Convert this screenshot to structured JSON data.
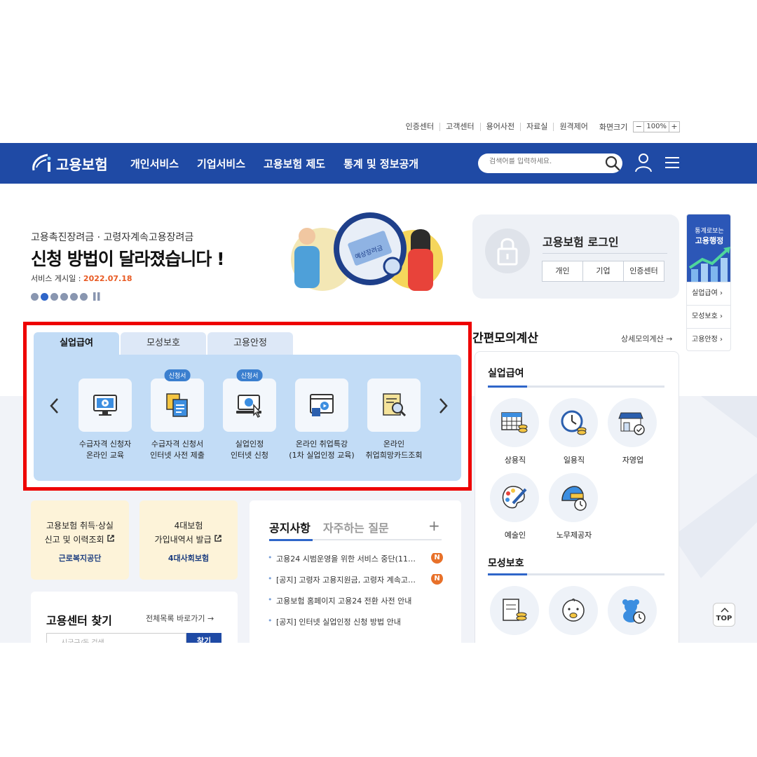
{
  "util": {
    "links": [
      "인증센터",
      "고객센터",
      "용어사전",
      "자료실",
      "원격제어"
    ],
    "zoom_label": "화면크기",
    "zoom_minus": "−",
    "zoom_value": "100%",
    "zoom_plus": "+"
  },
  "header": {
    "logo_text": "고용보험",
    "menu": [
      "개인서비스",
      "기업서비스",
      "고용보험 제도",
      "통계 및 정보공개"
    ],
    "search_placeholder": "검색어를 입력하세요."
  },
  "banner": {
    "subtitle": "고용촉진장려금 · 고령자계속고용장려금",
    "title": "신청 방법이 달라졌습니다 !",
    "date_label": "서비스 게시일 : ",
    "date_value": "2022.07.18",
    "illustration_tag": "예상장려금"
  },
  "login": {
    "title": "고용보험 로그인",
    "buttons": [
      "개인",
      "기업",
      "인증센터"
    ]
  },
  "quick_side": {
    "line1": "통계로보는",
    "line2": "고용행정",
    "items": [
      "실업급여 ›",
      "모성보호 ›",
      "고용안정 ›"
    ]
  },
  "service_tabs": {
    "tabs": [
      "실업급여",
      "모성보호",
      "고용안정"
    ],
    "active_tab": "실업급여",
    "items": [
      {
        "line1": "수급자격 신청자",
        "line2": "온라인 교육",
        "badge": ""
      },
      {
        "line1": "수급자격 신청서",
        "line2": "인터넷 사전 제출",
        "badge": "신청서"
      },
      {
        "line1": "실업인정",
        "line2": "인터넷 신청",
        "badge": "신청서"
      },
      {
        "line1": "온라인 취업특강",
        "line2": "(1차 실업인정 교육)",
        "badge": ""
      },
      {
        "line1": "온라인",
        "line2": "취업희망카드조회",
        "badge": ""
      }
    ]
  },
  "calc": {
    "title": "간편모의계산",
    "more": "상세모의계산 →",
    "section1": "실업급여",
    "section1_items": [
      "상용직",
      "일용직",
      "자영업",
      "예술인",
      "노무제공자"
    ],
    "section2": "모성보호"
  },
  "quick_links": [
    {
      "line1": "고용보험 취득·상실",
      "line2": "신고 및 이력조회",
      "org": "근로복지공단"
    },
    {
      "line1": "4대보험",
      "line2": "가입내역서 발급",
      "org": "4대사회보험"
    }
  ],
  "find_center": {
    "title": "고용센터 찾기",
    "more": "전체목록 바로가기 →",
    "placeholder": "시군구/동 검색",
    "button": "찾기"
  },
  "notice": {
    "tabs": [
      "공지사항",
      "자주하는 질문"
    ],
    "plus": "+",
    "items": [
      {
        "text": "고용24 시범운영을 위한 서비스 중단(11…",
        "new": "N"
      },
      {
        "text": "[공지] 고령자 고용지원금, 고령자 계속고…",
        "new": "N"
      },
      {
        "text": "고용보험 홈페이지 고용24 전환 사전 안내",
        "new": ""
      },
      {
        "text": "[공지] 인터넷 실업인정 신청 방법 안내",
        "new": ""
      }
    ]
  },
  "top_button": "TOP",
  "colors": {
    "brand": "#1f4aa5",
    "accent": "#2f66c9",
    "highlight": "#ee0000",
    "date": "#e85a23"
  }
}
